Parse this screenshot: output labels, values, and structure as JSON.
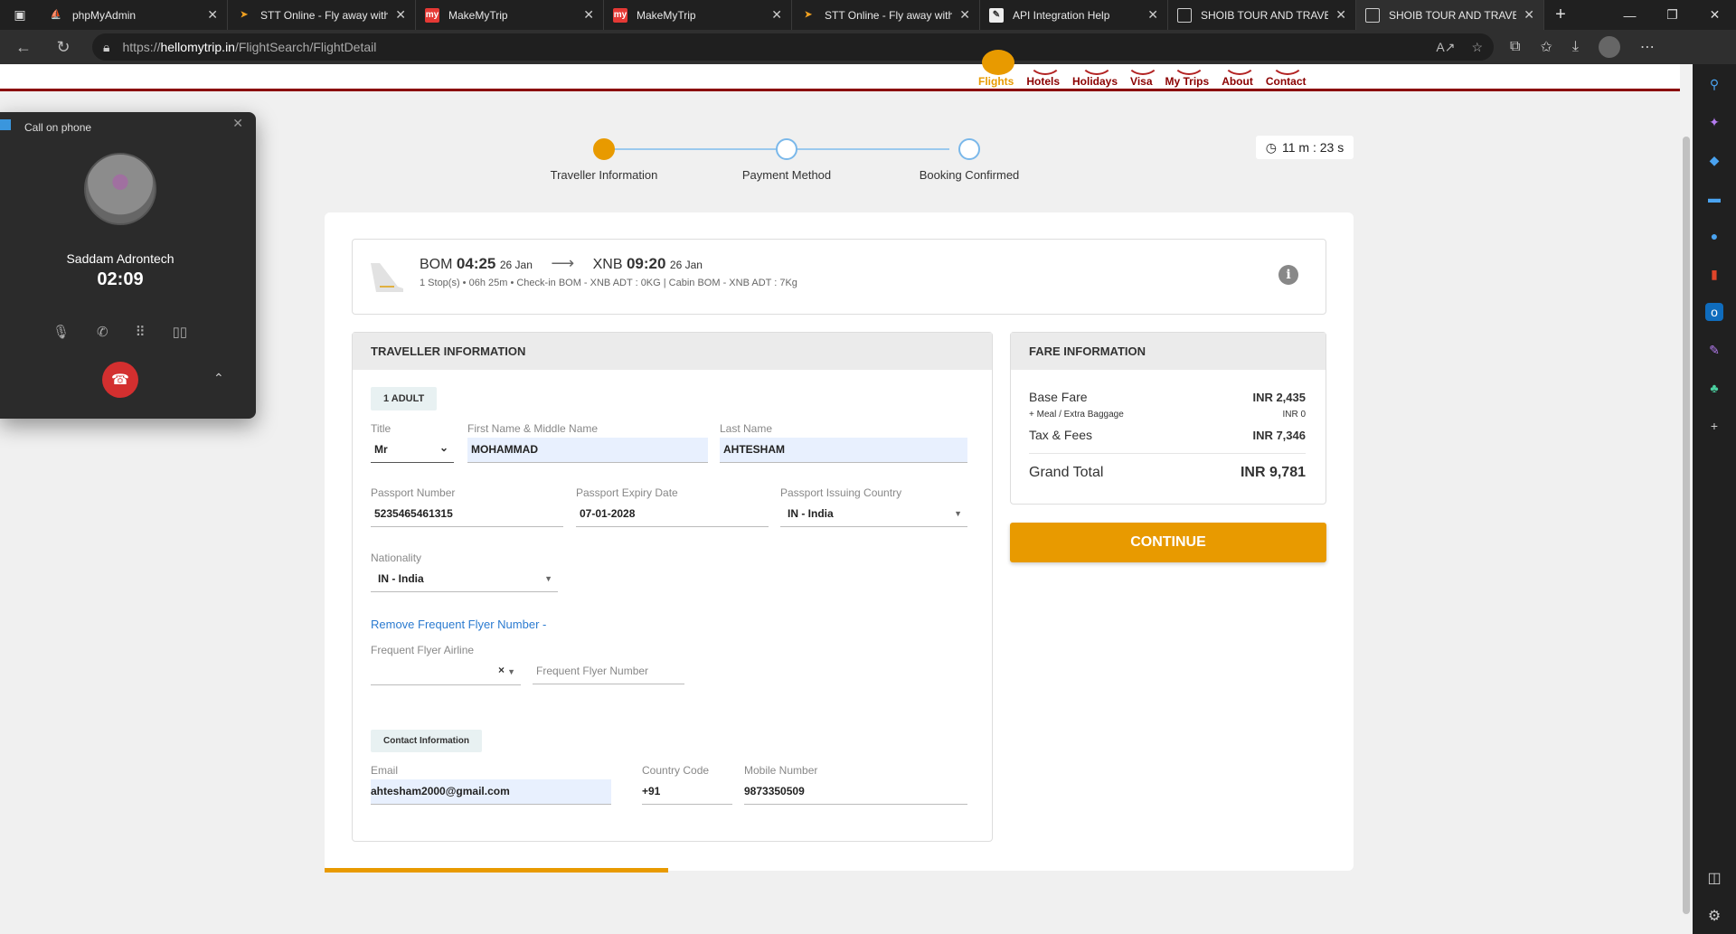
{
  "browser": {
    "tabs": [
      {
        "title": "phpMyAdmin",
        "favicon": "phpmyadmin-icon",
        "active": false
      },
      {
        "title": "STT Online - Fly away with",
        "favicon": "paper-plane-icon",
        "active": false
      },
      {
        "title": "MakeMyTrip",
        "favicon": "makemytrip-icon",
        "active": false
      },
      {
        "title": "MakeMyTrip",
        "favicon": "makemytrip-icon",
        "active": false
      },
      {
        "title": "STT Online - Fly away with",
        "favicon": "paper-plane-icon",
        "active": false
      },
      {
        "title": "API Integration Help",
        "favicon": "document-pen-icon",
        "active": false
      },
      {
        "title": "SHOIB TOUR AND TRAVEL",
        "favicon": "page-icon",
        "active": false
      },
      {
        "title": "SHOIB TOUR AND TRAVEL",
        "favicon": "page-icon",
        "active": true
      }
    ],
    "url_prefix": "https://",
    "url_host": "hellomytrip.in",
    "url_path": "/FlightSearch/FlightDetail"
  },
  "site_nav": {
    "items": [
      {
        "label": "Flights",
        "active": true
      },
      {
        "label": "Hotels",
        "active": false
      },
      {
        "label": "Holidays",
        "active": false
      },
      {
        "label": "Visa",
        "active": false
      },
      {
        "label": "My Trips",
        "active": false
      },
      {
        "label": "About",
        "active": false
      },
      {
        "label": "Contact",
        "active": false
      }
    ]
  },
  "stepper": {
    "steps": [
      {
        "label": "Traveller Information",
        "done": true
      },
      {
        "label": "Payment Method",
        "done": false
      },
      {
        "label": "Booking Confirmed",
        "done": false
      }
    ]
  },
  "timer": {
    "text": "11 m : 23 s"
  },
  "flight": {
    "from_code": "BOM",
    "dep_time": "04:25",
    "dep_date": "26 Jan",
    "to_code": "XNB",
    "arr_time": "09:20",
    "arr_date": "26 Jan",
    "details": "1 Stop(s) • 06h 25m • Check-in BOM - XNB ADT : 0KG | Cabin BOM - XNB ADT : 7Kg"
  },
  "traveller": {
    "heading": "TRAVELLER INFORMATION",
    "pax_chip": "1 ADULT",
    "title_label": "Title",
    "title_value": "Mr",
    "first_name_label": "First Name & Middle Name",
    "first_name_value": "MOHAMMAD",
    "last_name_label": "Last Name",
    "last_name_value": "AHTESHAM",
    "passport_no_label": "Passport Number",
    "passport_no_value": "5235465461315",
    "passport_exp_label": "Passport Expiry Date",
    "passport_exp_value": "07-01-2028",
    "passport_country_label": "Passport Issuing Country",
    "passport_country_value": "IN - India",
    "nationality_label": "Nationality",
    "nationality_value": "IN - India",
    "ff_link": "Remove Frequent Flyer Number  -",
    "ff_airline_label": "Frequent Flyer Airline",
    "ff_airline_clear": "×",
    "ff_number_placeholder": "Frequent Flyer Number",
    "contact_chip": "Contact Information",
    "email_label": "Email",
    "email_value": "ahtesham2000@gmail.com",
    "country_code_label": "Country Code",
    "country_code_value": "+91",
    "mobile_label": "Mobile Number",
    "mobile_value": "9873350509"
  },
  "fare": {
    "heading": "FARE INFORMATION",
    "base_label": "Base Fare",
    "base_value": "INR 2,435",
    "meal_label": "+ Meal / Extra Baggage",
    "meal_value": "INR 0",
    "tax_label": "Tax & Fees",
    "tax_value": "INR 7,346",
    "total_label": "Grand Total",
    "total_value": "INR 9,781"
  },
  "continue_label": "CONTINUE",
  "call": {
    "header": "Call on phone",
    "name": "Saddam Adrontech",
    "duration": "02:09"
  },
  "colors": {
    "accent": "#e89a00",
    "brand": "#8b0000",
    "link": "#2b7bd0"
  }
}
